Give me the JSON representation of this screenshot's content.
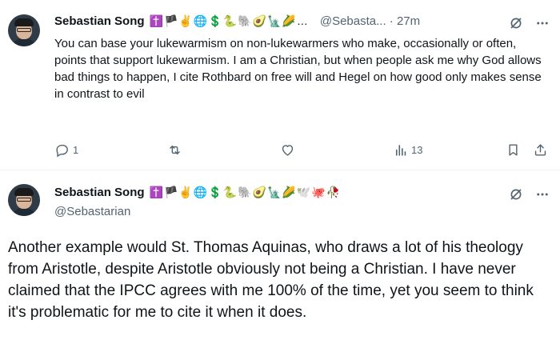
{
  "tweet1": {
    "author_name": "Sebastian Song",
    "emojis": "✝️🏴✌️🌐💲🐍🐘🥑🗽🌽…",
    "handle_time": "@Sebasta... · 27m",
    "text": "You can base your lukewarmism on non-lukewarmers who make, occasionally or often, points that support lukewarmism. I am a Christian, but when people ask me why God allows bad things to happen, I cite Rothbard on free will and Hegel on how good only makes sense in contrast to evil",
    "reply_count": "1",
    "retweet_count": "",
    "like_count": "",
    "view_count": "13"
  },
  "tweet2": {
    "author_name": "Sebastian Song",
    "emojis": "✝️🏴✌️🌐💲🐍🐘🥑🗽🌽🕊️🐙🥀",
    "handle": "@Sebastarian",
    "text": "Another example would St. Thomas Aquinas, who draws a lot of his theology from Aristotle, despite Aristotle obviously not being a Christian. I have never claimed that the IPCC agrees with me 100% of the time, yet you seem to think it's problematic for me to cite it when it does."
  },
  "icons": {
    "reply": "speech-bubble-icon",
    "retweet": "retweet-icon",
    "like": "heart-icon",
    "views": "bar-chart-icon",
    "bookmark": "bookmark-icon",
    "share": "share-icon",
    "grok": "slash-circle-icon",
    "more": "more-dots-icon"
  },
  "colors": {
    "text": "#0f1419",
    "secondary": "#536471",
    "divider": "#eff3f4"
  }
}
